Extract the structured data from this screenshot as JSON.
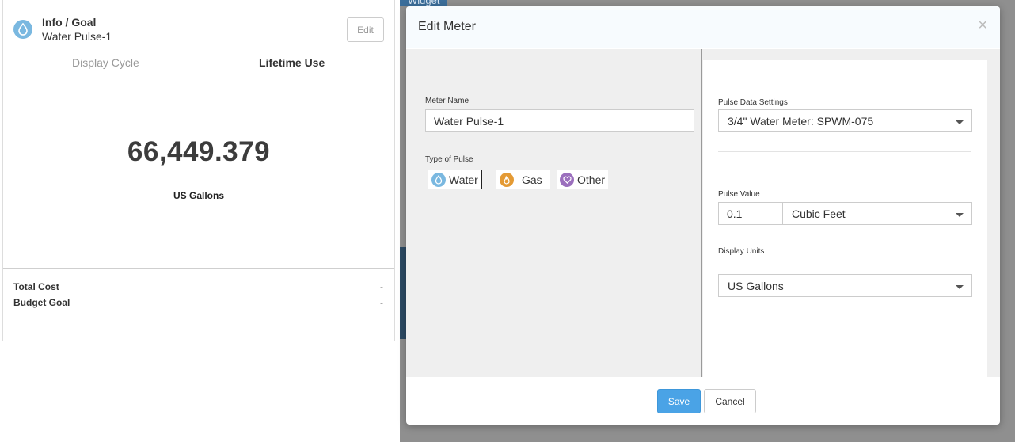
{
  "card": {
    "title": "Info / Goal",
    "subtitle": "Water Pulse-1",
    "edit_label": "Edit",
    "tabs": [
      {
        "label": "Display Cycle",
        "active": false
      },
      {
        "label": "Lifetime Use",
        "active": true
      }
    ],
    "value": "66,449.379",
    "units": "US Gallons",
    "footer": {
      "total_cost_label": "Total Cost",
      "total_cost_value": "-",
      "budget_goal_label": "Budget Goal",
      "budget_goal_value": "-"
    },
    "icon": "water-drop-icon"
  },
  "background": {
    "partial_text": "Widget"
  },
  "modal": {
    "title": "Edit Meter",
    "close_glyph": "×",
    "meter_name_label": "Meter Name",
    "meter_name_value": "Water Pulse-1",
    "type_of_pulse_label": "Type of Pulse",
    "pulse_types": [
      {
        "label": "Water",
        "icon": "water-drop-icon",
        "color": "#7ab8e0",
        "selected": true
      },
      {
        "label": "Gas",
        "icon": "flame-icon",
        "color": "#e49a34",
        "selected": false
      },
      {
        "label": "Other",
        "icon": "heart-icon",
        "color": "#9b6fbd",
        "selected": false
      }
    ],
    "pulse_data_settings_label": "Pulse Data Settings",
    "pulse_data_settings_value": "3/4\" Water Meter: SPWM-075",
    "pulse_value_label": "Pulse Value",
    "pulse_value": "0.1",
    "pulse_value_unit": "Cubic Feet",
    "display_units_label": "Display Units",
    "display_units_value": "US Gallons",
    "save_label": "Save",
    "cancel_label": "Cancel"
  },
  "colors": {
    "accent": "#4aa3e6",
    "header_border": "#7aaed3"
  }
}
